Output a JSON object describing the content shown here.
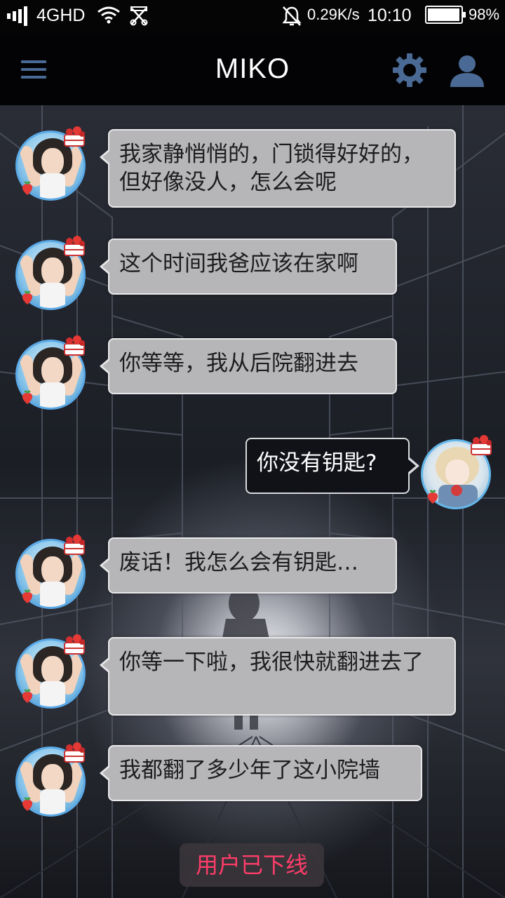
{
  "status_bar": {
    "network": "4GHD",
    "speed": "0.29K/s",
    "time": "10:10",
    "battery_percent": "98%",
    "battery_level": 0.98,
    "icons": [
      "signal-icon",
      "wifi-icon",
      "cast-icon",
      "bell-off-icon",
      "battery-icon"
    ]
  },
  "app_bar": {
    "title": "MIKO",
    "accent_color": "#4a6a95",
    "icons": [
      "menu-icon",
      "gear-icon",
      "user-icon"
    ]
  },
  "messages": [
    {
      "from": "other",
      "text": "我家静悄悄的，门锁得好好的，但好像没人，怎么会呢"
    },
    {
      "from": "other",
      "text": "这个时间我爸应该在家啊"
    },
    {
      "from": "other",
      "text": "你等等，我从后院翻进去"
    },
    {
      "from": "me",
      "text": "你没有钥匙?"
    },
    {
      "from": "other",
      "text": "废话！我怎么会有钥匙…"
    },
    {
      "from": "other",
      "text": "你等一下啦，我很快就翻进去了"
    },
    {
      "from": "other",
      "text": "我都翻了多少年了这小院墙"
    }
  ],
  "status_notice": {
    "text": "用户已下线",
    "color": "#ff3d6a"
  }
}
